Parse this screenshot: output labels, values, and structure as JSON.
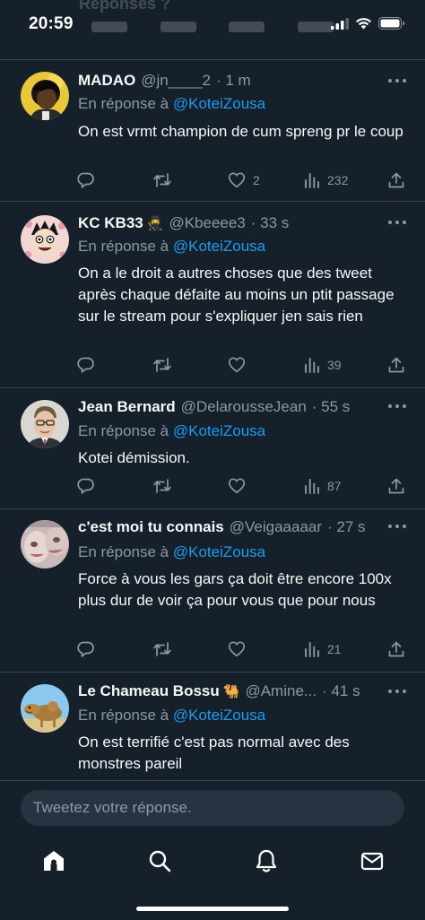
{
  "status_bar": {
    "time": "20:59",
    "ghost_title": "Réponses ?",
    "icons": [
      "cellular-icon",
      "wifi-icon",
      "battery-icon"
    ]
  },
  "colors": {
    "background": "#15202b",
    "divider": "#38444d",
    "mention": "#1d9bf0",
    "secondary_text": "#8b98a5",
    "primary_text": "#f7f9f9"
  },
  "reply_prefix": "En réponse à",
  "tweets": [
    {
      "name": "MADAO",
      "name_emoji": "",
      "handle": "@jn____2",
      "time": "· 1 m",
      "mention": "@KoteiZousa",
      "text": "On est vrmt champion de cum spreng pr le coup",
      "likes": "2",
      "views": "232"
    },
    {
      "name": "KC KB33",
      "name_emoji": "🥷",
      "handle": "@Kbeeee3",
      "time": "· 33 s",
      "mention": "@KoteiZousa",
      "text": "On a le droit a autres choses que des tweet après chaque défaite au moins un ptit passage sur le stream pour s'expliquer jen sais rien",
      "likes": "",
      "views": "39"
    },
    {
      "name": "Jean Bernard",
      "name_emoji": "",
      "handle": "@DelarousseJean",
      "time": "· 55 s",
      "mention": "@KoteiZousa",
      "text": "Kotei démission.",
      "likes": "",
      "views": "87"
    },
    {
      "name": "c'est moi tu connais",
      "name_emoji": "",
      "handle": "@Veigaaaaar",
      "time": "· 27 s",
      "mention": "@KoteiZousa",
      "text": "Force à vous les gars ça doit être encore 100x plus dur de voir ça pour vous que pour nous",
      "likes": "",
      "views": "21"
    },
    {
      "name": "Le Chameau Bossu",
      "name_emoji": "🐫",
      "handle": "@Amine...",
      "time": "· 41 s",
      "mention": "@KoteiZousa",
      "text": "On est terrifié c'est pas normal avec des monstres pareil",
      "likes": "",
      "views": ""
    }
  ],
  "composer": {
    "placeholder": "Tweetez votre réponse."
  },
  "bottom_nav": [
    "home-icon",
    "search-icon",
    "notifications-icon",
    "messages-icon"
  ]
}
